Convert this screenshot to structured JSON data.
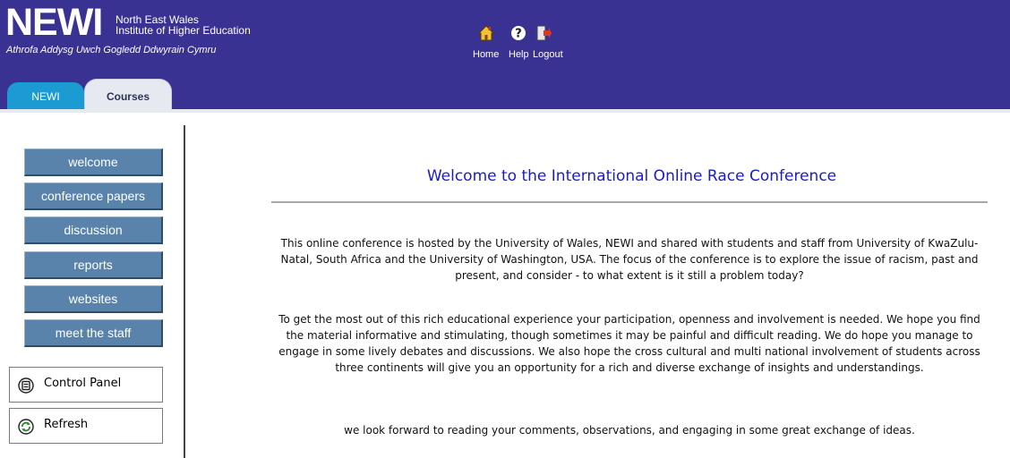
{
  "header": {
    "logo_mark": "NEWI",
    "logo_line1": "North East Wales",
    "logo_line2": "Institute of Higher Education",
    "logo_welsh": "Athrofa Addysg Uwch Gogledd Ddwyrain Cymru",
    "nav": [
      {
        "label": "Home",
        "icon": "home-icon"
      },
      {
        "label": "Help",
        "icon": "help-icon"
      },
      {
        "label": "Logout",
        "icon": "logout-icon"
      }
    ],
    "colors": {
      "background": "#3a3292",
      "tab_newi": "#1b9bd1",
      "tab_active": "#e6e9ef"
    }
  },
  "tabs": [
    {
      "label": "NEWI",
      "active": false
    },
    {
      "label": "Courses",
      "active": true
    }
  ],
  "sidebar": {
    "menu": [
      {
        "label": "welcome"
      },
      {
        "label": "conference papers"
      },
      {
        "label": "discussion"
      },
      {
        "label": "reports"
      },
      {
        "label": "websites"
      },
      {
        "label": "meet the staff"
      }
    ],
    "tools": [
      {
        "label": "Control Panel",
        "icon": "control-panel-icon"
      },
      {
        "label": "Refresh",
        "icon": "refresh-icon"
      }
    ],
    "colors": {
      "menu_button": "#5a83ac"
    }
  },
  "main": {
    "title": "Welcome to the International Online Race Conference",
    "paragraphs": [
      "This online conference is hosted by the University of Wales, NEWI and shared with students and staff from University of KwaZulu-Natal, South Africa and the University of Washington, USA. The focus of the conference is to explore the issue of racism, past and present, and consider - to what extent is it still a problem today?",
      "To get the most out of this rich educational experience your participation, openness and involvement is needed. We hope you find the material informative and stimulating, though sometimes it may be painful and difficult reading. We do hope you manage to engage in some lively debates and discussions. We also hope the cross cultural and multi national involvement of students across three continents will give you an opportunity for a rich and diverse exchange of insights and understandings.",
      "we look forward to reading your comments, observations, and engaging in some great exchange of ideas."
    ],
    "colors": {
      "title": "#1b1bc8"
    }
  }
}
